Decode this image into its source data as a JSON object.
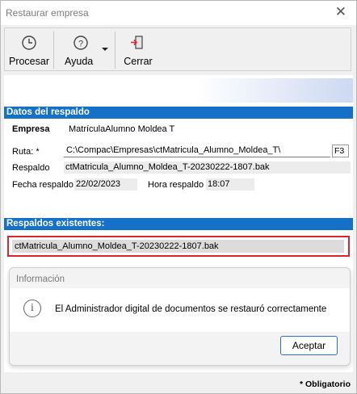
{
  "window": {
    "title": "Restaurar empresa",
    "close_glyph": "✕"
  },
  "toolbar": {
    "procesar_label": "Procesar",
    "ayuda_label": "Ayuda",
    "cerrar_label": "Cerrar",
    "icons": [
      "clock-icon",
      "help-icon",
      "exit-door-icon"
    ]
  },
  "datos_respaldo": {
    "header": "Datos del respaldo",
    "empresa_label": "Empresa",
    "empresa_value": "MatrículaAlumno Moldea T",
    "ruta_label": "Ruta: *",
    "ruta_value": "C:\\Compac\\Empresas\\ctMatricula_Alumno_Moldea_T\\",
    "f3_label": "F3",
    "respaldo_label": "Respaldo",
    "respaldo_value": "ctMatricula_Alumno_Moldea_T-20230222-1807.bak",
    "fecha_label": "Fecha respaldo",
    "fecha_value": "22/02/2023",
    "hora_label": "Hora respaldo",
    "hora_value": "18:07"
  },
  "respaldos_existentes": {
    "header": "Respaldos existentes:",
    "items": [
      "ctMatricula_Alumno_Moldea_T-20230222-1807.bak"
    ]
  },
  "info_dialog": {
    "title": "Información",
    "icon": "info-icon",
    "message": "El Administrador digital de documentos se restauró correctamente",
    "ok_label": "Aceptar"
  },
  "footer": {
    "required_note": "* Obligatorio"
  },
  "colors": {
    "section_header": "#1570c8",
    "highlight_border": "#d9262f",
    "primary_button_border": "#2f6fc4"
  }
}
